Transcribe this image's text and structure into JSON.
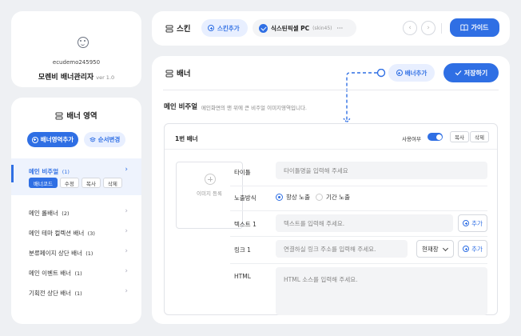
{
  "profile": {
    "user_id": "ecudemo245950",
    "name": "모렌비 배너관리자",
    "version": "ver 1.0"
  },
  "sidebar": {
    "title": "배너 영역",
    "add_area_label": "배너영역추가",
    "reorder_label": "순서변경",
    "active_item": {
      "label": "메인 비주얼",
      "count": "(1)",
      "actions": [
        "배너코드",
        "수정",
        "복사",
        "삭제"
      ]
    },
    "items": [
      {
        "label": "메인 롤배너",
        "count": "(2)"
      },
      {
        "label": "메인 테마 컬렉션 배너",
        "count": "(3)"
      },
      {
        "label": "분류페이지 상단 배너",
        "count": "(1)"
      },
      {
        "label": "메인 이벤트 배너",
        "count": "(1)"
      },
      {
        "label": "기획전 상단 배너",
        "count": "(1)"
      }
    ]
  },
  "topbar": {
    "title": "스킨",
    "add_skin_label": "스킨추가",
    "skin_name": "식스틴픽셀 PC",
    "skin_code": "(skin45)",
    "more": "···",
    "guide_label": "가이드"
  },
  "main": {
    "title": "배너",
    "add_banner_label": "배너추가",
    "save_label": "저장하기",
    "section_title": "메인 비주얼",
    "section_desc": "메인화면의 맨 위에 큰 비주얼 이미지영역입니다.",
    "panel": {
      "title": "1번 배너",
      "toggle_label": "사용여부",
      "toggle_on": true,
      "copy_label": "복사",
      "delete_label": "삭제",
      "image_label": "이미지 등록",
      "fields": {
        "title_label": "타이틀",
        "title_placeholder": "타이틀명을 입력해 주세요",
        "display_label": "노출방식",
        "display_options": [
          "항상 노출",
          "기간 노출"
        ],
        "display_selected": "항상 노출",
        "text_label": "텍스트 1",
        "text_placeholder": "텍스트를 입력해 주세요.",
        "link_label": "링크 1",
        "link_placeholder": "연결하실 링크 주소를 입력해 주세요.",
        "link_target": "현재창",
        "html_label": "HTML",
        "html_placeholder": "HTML 소스를 입력해 주세요.",
        "add_label": "추가"
      }
    }
  },
  "colors": {
    "accent": "#2f6fe4",
    "background": "#eef0f3"
  }
}
